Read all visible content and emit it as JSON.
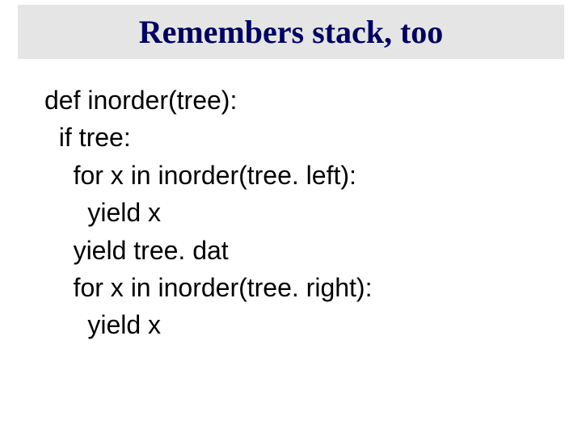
{
  "title": "Remembers stack, too",
  "code": {
    "l1": "def inorder(tree):",
    "l2": "  if tree:",
    "l3": "    for x in inorder(tree. left):",
    "l4": "      yield x",
    "l5": "    yield tree. dat",
    "l6": "    for x in inorder(tree. right):",
    "l7": "      yield x"
  }
}
